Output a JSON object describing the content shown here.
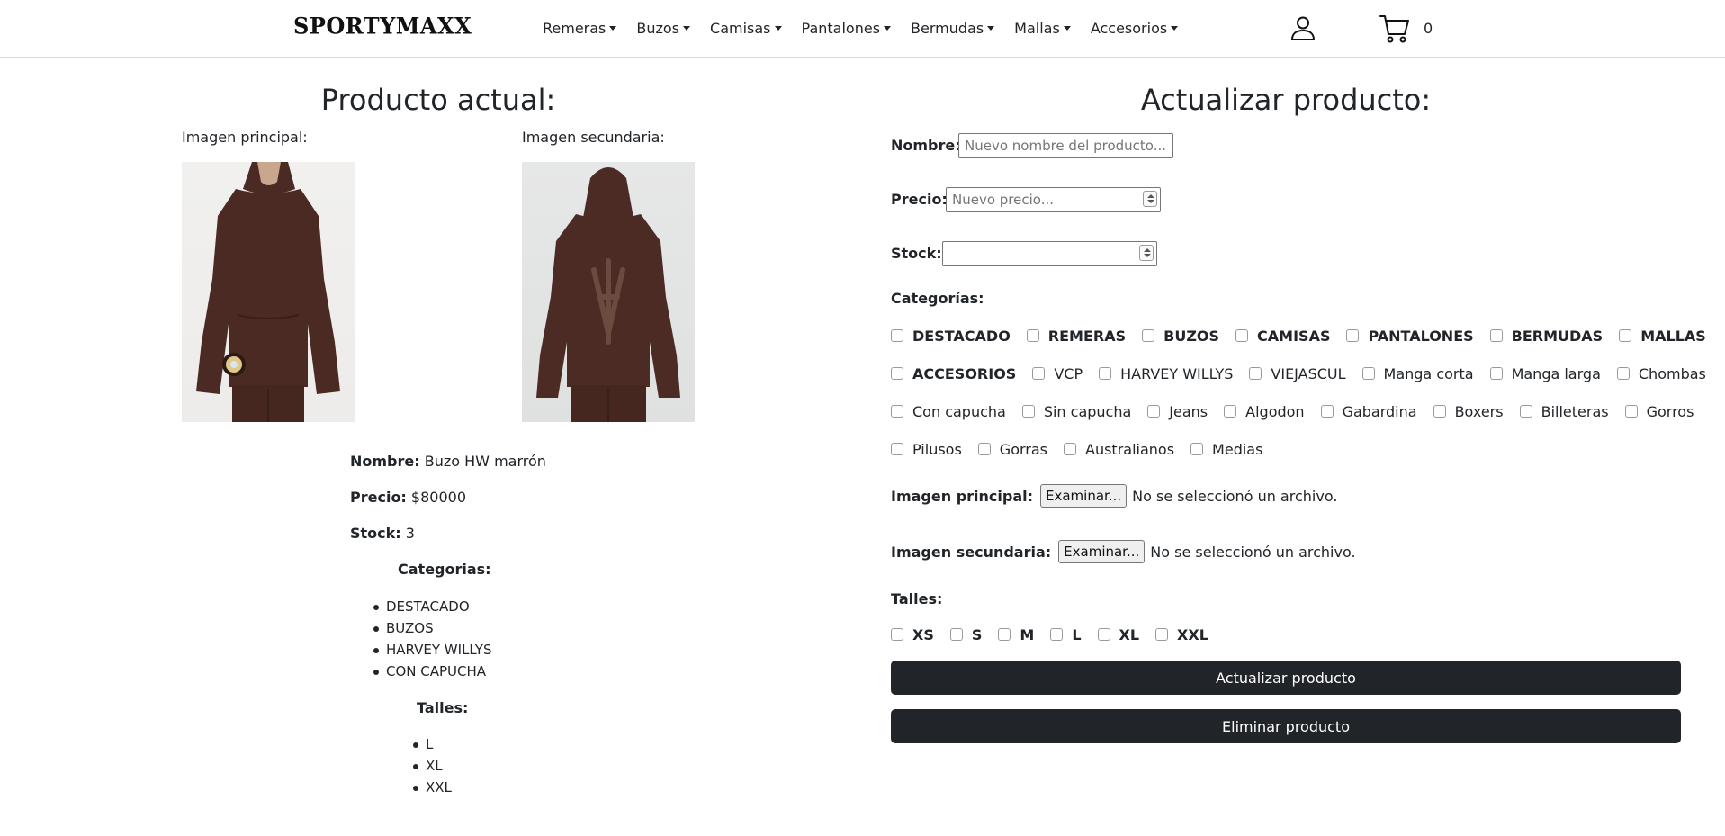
{
  "navbar": {
    "brand": "SPORTYMAXX",
    "items": [
      {
        "label": "Remeras"
      },
      {
        "label": "Buzos"
      },
      {
        "label": "Camisas"
      },
      {
        "label": "Pantalones"
      },
      {
        "label": "Bermudas"
      },
      {
        "label": "Mallas"
      },
      {
        "label": "Accesorios"
      }
    ],
    "user_icon": "user-icon",
    "cart_icon": "cart-icon",
    "cart_count": "0"
  },
  "current": {
    "title": "Producto actual:",
    "main_image_label": "Imagen principal:",
    "secondary_image_label": "Imagen secundaria:",
    "name_label": "Nombre:",
    "name_value": "Buzo HW marrón",
    "price_label": "Precio:",
    "price_value": "$80000",
    "stock_label": "Stock:",
    "stock_value": "3",
    "categories_label": "Categorias:",
    "categories": [
      "DESTACADO",
      "BUZOS",
      "HARVEY WILLYS",
      "CON CAPUCHA"
    ],
    "sizes_label": "Talles:",
    "sizes": [
      "L",
      "XL",
      "XXL"
    ]
  },
  "form": {
    "title": "Actualizar producto:",
    "name_label": "Nombre:",
    "name_placeholder": "Nuevo nombre del producto...",
    "price_label": "Precio:",
    "price_placeholder": "Nuevo precio...",
    "stock_label": "Stock:",
    "stock_placeholder": "",
    "categories_label": "Categorías:",
    "categories": [
      {
        "label": "DESTACADO",
        "bold": true
      },
      {
        "label": "REMERAS",
        "bold": true
      },
      {
        "label": "BUZOS",
        "bold": true
      },
      {
        "label": "CAMISAS",
        "bold": true
      },
      {
        "label": "PANTALONES",
        "bold": true
      },
      {
        "label": "BERMUDAS",
        "bold": true
      },
      {
        "label": "MALLAS",
        "bold": true
      },
      {
        "label": "ACCESORIOS",
        "bold": true
      },
      {
        "label": "VCP",
        "bold": false
      },
      {
        "label": "HARVEY WILLYS",
        "bold": false
      },
      {
        "label": "VIEJASCUL",
        "bold": false
      },
      {
        "label": "Manga corta",
        "bold": false
      },
      {
        "label": "Manga larga",
        "bold": false
      },
      {
        "label": "Chombas",
        "bold": false
      },
      {
        "label": "Con capucha",
        "bold": false
      },
      {
        "label": "Sin capucha",
        "bold": false
      },
      {
        "label": "Jeans",
        "bold": false
      },
      {
        "label": "Algodon",
        "bold": false
      },
      {
        "label": "Gabardina",
        "bold": false
      },
      {
        "label": "Boxers",
        "bold": false
      },
      {
        "label": "Billeteras",
        "bold": false
      },
      {
        "label": "Gorros",
        "bold": false
      },
      {
        "label": "Pilusos",
        "bold": false
      },
      {
        "label": "Gorras",
        "bold": false
      },
      {
        "label": "Australianos",
        "bold": false
      },
      {
        "label": "Medias",
        "bold": false
      }
    ],
    "main_image_label": "Imagen principal:",
    "secondary_image_label": "Imagen secundaria:",
    "browse_label": "Examinar...",
    "no_file_text": "No se seleccionó un archivo.",
    "sizes_label": "Talles:",
    "sizes": [
      "XS",
      "S",
      "M",
      "L",
      "XL",
      "XXL"
    ],
    "update_button": "Actualizar producto",
    "delete_button": "Eliminar producto"
  },
  "colors": {
    "dark_button": "#212529",
    "text": "#212529",
    "hoodie_brown": "#4a2a22"
  }
}
